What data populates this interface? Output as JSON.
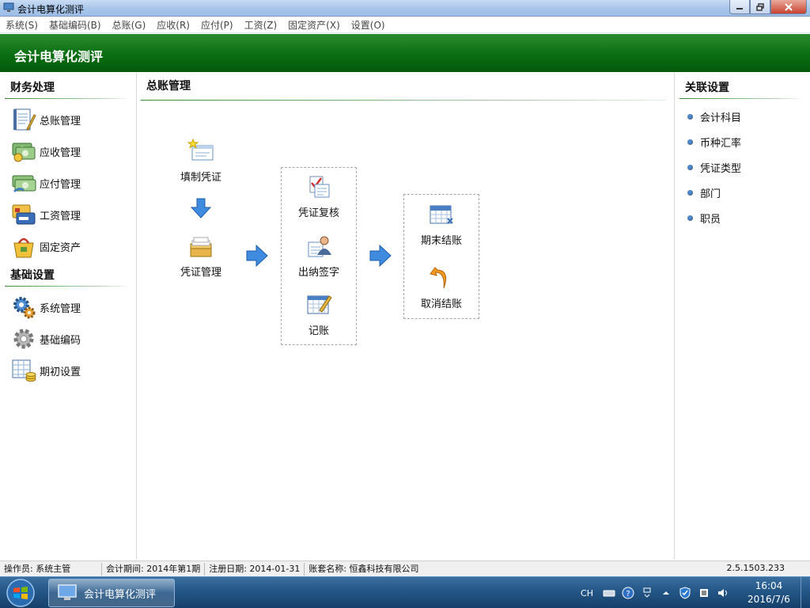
{
  "window": {
    "title": "会计电算化测评",
    "min_icon": "minimize-icon",
    "max_icon": "restore-icon",
    "close_icon": "close-icon"
  },
  "menu": [
    {
      "label": "系统(S)"
    },
    {
      "label": "基础编码(B)"
    },
    {
      "label": "总账(G)"
    },
    {
      "label": "应收(R)"
    },
    {
      "label": "应付(P)"
    },
    {
      "label": "工资(Z)"
    },
    {
      "label": "固定资产(X)"
    },
    {
      "label": "设置(O)"
    }
  ],
  "banner": {
    "title": "会计电算化测评",
    "color": "#0b6e12"
  },
  "left": {
    "finance": {
      "title": "财务处理",
      "items": [
        {
          "label": "总账管理",
          "icon": "ledger-book-icon"
        },
        {
          "label": "应收管理",
          "icon": "receivable-money-icon"
        },
        {
          "label": "应付管理",
          "icon": "payable-money-icon"
        },
        {
          "label": "工资管理",
          "icon": "payroll-card-icon"
        },
        {
          "label": "固定资产",
          "icon": "asset-bag-icon"
        }
      ]
    },
    "basic": {
      "title": "基础设置",
      "items": [
        {
          "label": "系统管理",
          "icon": "gears-icon"
        },
        {
          "label": "基础编码",
          "icon": "gear-icon"
        },
        {
          "label": "期初设置",
          "icon": "spreadsheet-coins-icon"
        }
      ]
    }
  },
  "center": {
    "title": "总账管理",
    "nodes": {
      "fill_voucher": {
        "label": "填制凭证",
        "icon": "new-voucher-icon"
      },
      "voucher_mgmt": {
        "label": "凭证管理",
        "icon": "voucher-stack-icon"
      },
      "review": {
        "label": "凭证复核",
        "icon": "checklist-icon"
      },
      "cashier_sign": {
        "label": "出纳签字",
        "icon": "user-sign-icon"
      },
      "post": {
        "label": "记账",
        "icon": "post-ledger-icon"
      },
      "period_close": {
        "label": "期末结账",
        "icon": "calendar-close-icon"
      },
      "cancel_close": {
        "label": "取消结账",
        "icon": "undo-arrow-icon"
      }
    }
  },
  "right": {
    "title": "关联设置",
    "items": [
      {
        "label": "会计科目"
      },
      {
        "label": "币种汇率"
      },
      {
        "label": "凭证类型"
      },
      {
        "label": "部门"
      },
      {
        "label": "职员"
      }
    ]
  },
  "status": {
    "operator": "操作员: 系统主管",
    "period": "会计期间: 2014年第1期",
    "register_date": "注册日期: 2014-01-31",
    "account_set": "账套名称: 恒鑫科技有限公司",
    "version": "2.5.1503.233"
  },
  "taskbar": {
    "task_label": "会计电算化测评",
    "lang": "CH",
    "time": "16:04",
    "date": "2016/7/6"
  }
}
